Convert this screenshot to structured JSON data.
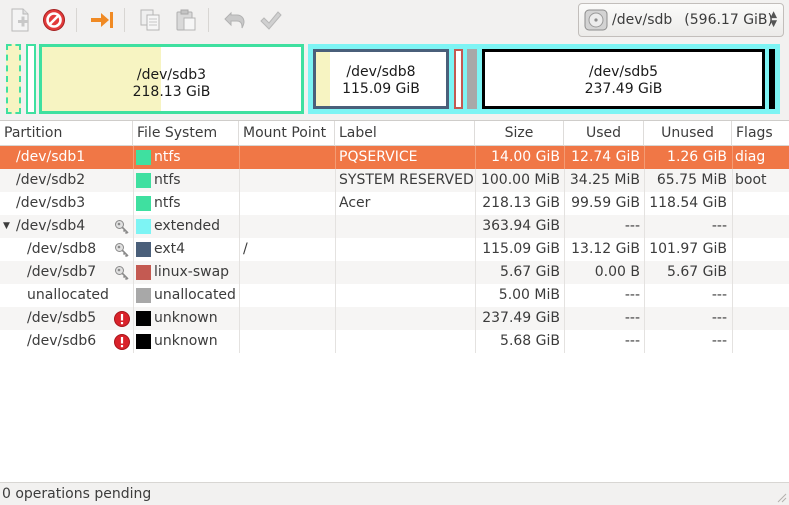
{
  "device": {
    "name": "/dev/sdb",
    "size": "(596.17 GiB)"
  },
  "graph": [
    {
      "name": "/dev/sdb3",
      "size": "218.13 GiB"
    },
    {
      "name": "/dev/sdb8",
      "size": "115.09 GiB"
    },
    {
      "name": "/dev/sdb5",
      "size": "237.49 GiB"
    }
  ],
  "columns": [
    "Partition",
    "File System",
    "Mount Point",
    "Label",
    "Size",
    "Used",
    "Unused",
    "Flags"
  ],
  "rows": [
    {
      "partition": "/dev/sdb1",
      "fs": "ntfs",
      "fs_color": "#3fe0a0",
      "mount": "",
      "label": "PQSERVICE",
      "size": "14.00 GiB",
      "used": "12.74 GiB",
      "unused": "1.26 GiB",
      "flags": "diag",
      "icon": ""
    },
    {
      "partition": "/dev/sdb2",
      "fs": "ntfs",
      "fs_color": "#3fe0a0",
      "mount": "",
      "label": "SYSTEM RESERVED",
      "size": "100.00 MiB",
      "used": "34.25 MiB",
      "unused": "65.75 MiB",
      "flags": "boot",
      "icon": ""
    },
    {
      "partition": "/dev/sdb3",
      "fs": "ntfs",
      "fs_color": "#3fe0a0",
      "mount": "",
      "label": "Acer",
      "size": "218.13 GiB",
      "used": "99.59 GiB",
      "unused": "118.54 GiB",
      "flags": "",
      "icon": ""
    },
    {
      "partition": "/dev/sdb4",
      "fs": "extended",
      "fs_color": "#7df4f4",
      "mount": "",
      "label": "",
      "size": "363.94 GiB",
      "used": "---",
      "unused": "---",
      "flags": "",
      "icon": "key"
    },
    {
      "partition": "/dev/sdb8",
      "fs": "ext4",
      "fs_color": "#4a5f7a",
      "mount": "/",
      "label": "",
      "size": "115.09 GiB",
      "used": "13.12 GiB",
      "unused": "101.97 GiB",
      "flags": "",
      "icon": "key"
    },
    {
      "partition": "/dev/sdb7",
      "fs": "linux-swap",
      "fs_color": "#c45a52",
      "mount": "",
      "label": "",
      "size": "5.67 GiB",
      "used": "0.00 B",
      "unused": "5.67 GiB",
      "flags": "",
      "icon": "key"
    },
    {
      "partition": "unallocated",
      "fs": "unallocated",
      "fs_color": "#a8a8a8",
      "mount": "",
      "label": "",
      "size": "5.00 MiB",
      "used": "---",
      "unused": "---",
      "flags": "",
      "icon": ""
    },
    {
      "partition": "/dev/sdb5",
      "fs": "unknown",
      "fs_color": "#000000",
      "mount": "",
      "label": "",
      "size": "237.49 GiB",
      "used": "---",
      "unused": "---",
      "flags": "",
      "icon": "error"
    },
    {
      "partition": "/dev/sdb6",
      "fs": "unknown",
      "fs_color": "#000000",
      "mount": "",
      "label": "",
      "size": "5.68 GiB",
      "used": "---",
      "unused": "---",
      "flags": "",
      "icon": "error"
    }
  ],
  "status": "0 operations pending",
  "colors": {
    "selection": "#f07746",
    "ntfs": "#3fe0a0",
    "extended": "#7df4f4",
    "ext4": "#4a5f7a",
    "swap": "#c45a52",
    "unallocated": "#a8a8a8",
    "used_fill": "#f7f4c2"
  }
}
